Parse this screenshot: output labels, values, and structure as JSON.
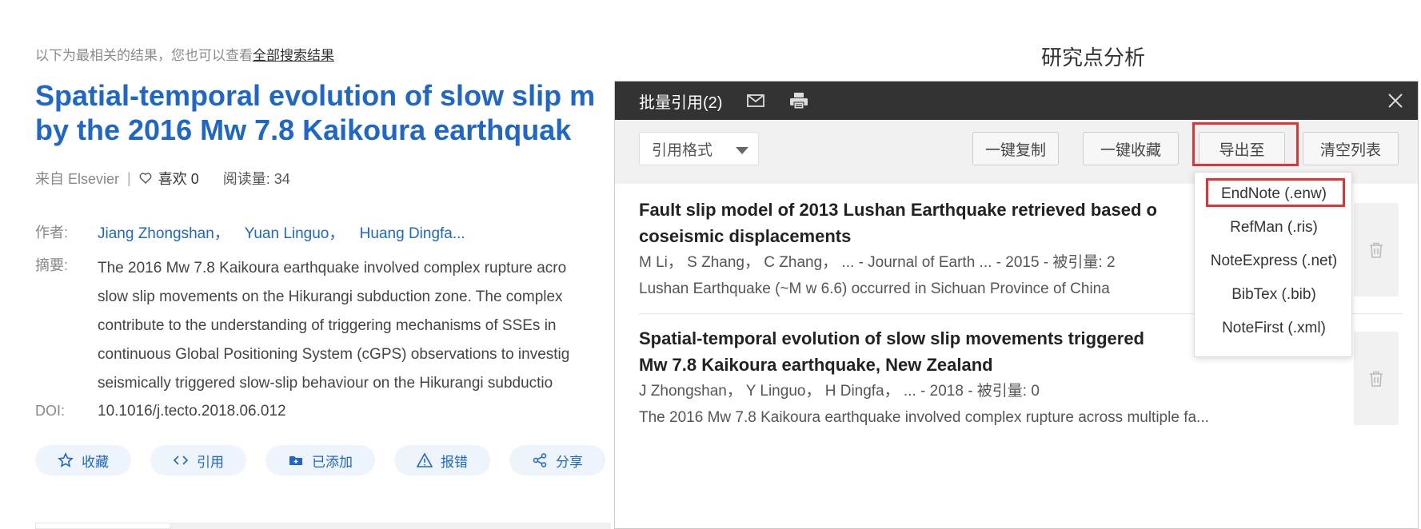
{
  "hint": {
    "text": "以下为最相关的结果，您也可以查看",
    "link": "全部搜索结果"
  },
  "article": {
    "title_line1": "Spatial-temporal evolution of slow slip m",
    "title_line2": "by the 2016 Mw 7.8 Kaikoura earthquak",
    "source": "来自 Elsevier",
    "sep": "|",
    "likes_label": "喜欢 0",
    "reads_label": "阅读量:  34",
    "authors_label": "作者:",
    "authors": [
      "Jiang Zhongshan，",
      "Yuan Linguo，",
      "Huang Dingfa..."
    ],
    "abstract_label": "摘要:",
    "abstract_lines": [
      "The 2016 Mw 7.8 Kaikoura earthquake involved complex rupture acro",
      "slow slip movements on the Hikurangi subduction zone. The complex",
      "contribute to the understanding of triggering mechanisms of SSEs in",
      "continuous Global Positioning System (cGPS) observations to investig",
      "seismically triggered slow-slip behaviour on the Hikurangi subductio"
    ],
    "doi_label": "DOI:",
    "doi": "10.1016/j.tecto.2018.06.012"
  },
  "actions": [
    "收藏",
    "引用",
    "已添加",
    "报错",
    "分享"
  ],
  "right_heading": "研究点分析",
  "modal": {
    "title": "批量引用(2)",
    "format_select": "引用格式",
    "buttons": {
      "copy": "一键复制",
      "collect": "一键收藏",
      "export": "导出至",
      "clear": "清空列表"
    },
    "entries": [
      {
        "title1": "Fault slip model of 2013 Lushan Earthquake retrieved based o",
        "title2": "coseismic displacements",
        "meta": "M Li，  S Zhang，  C Zhang，  ... - Journal of Earth ... - 2015 - 被引量: 2",
        "abstract": "Lushan Earthquake (~M w 6.6) occurred in Sichuan Province of China"
      },
      {
        "title1": "Spatial-temporal evolution of slow slip movements triggered",
        "title2": "Mw 7.8 Kaikoura earthquake, New Zealand",
        "meta": "J Zhongshan，  Y Linguo，  H Dingfa，  ... - 2018 - 被引量: 0",
        "abstract": "The 2016 Mw 7.8 Kaikoura earthquake involved complex rupture across multiple fa..."
      }
    ],
    "export_options": [
      "EndNote (.enw)",
      "RefMan (.ris)",
      "NoteExpress (.net)",
      "BibTex (.bib)",
      "NoteFirst (.xml)"
    ]
  },
  "colors": {
    "link_blue": "#1f66c9",
    "modal_header": "#333333",
    "highlight_red": "#e53333"
  }
}
